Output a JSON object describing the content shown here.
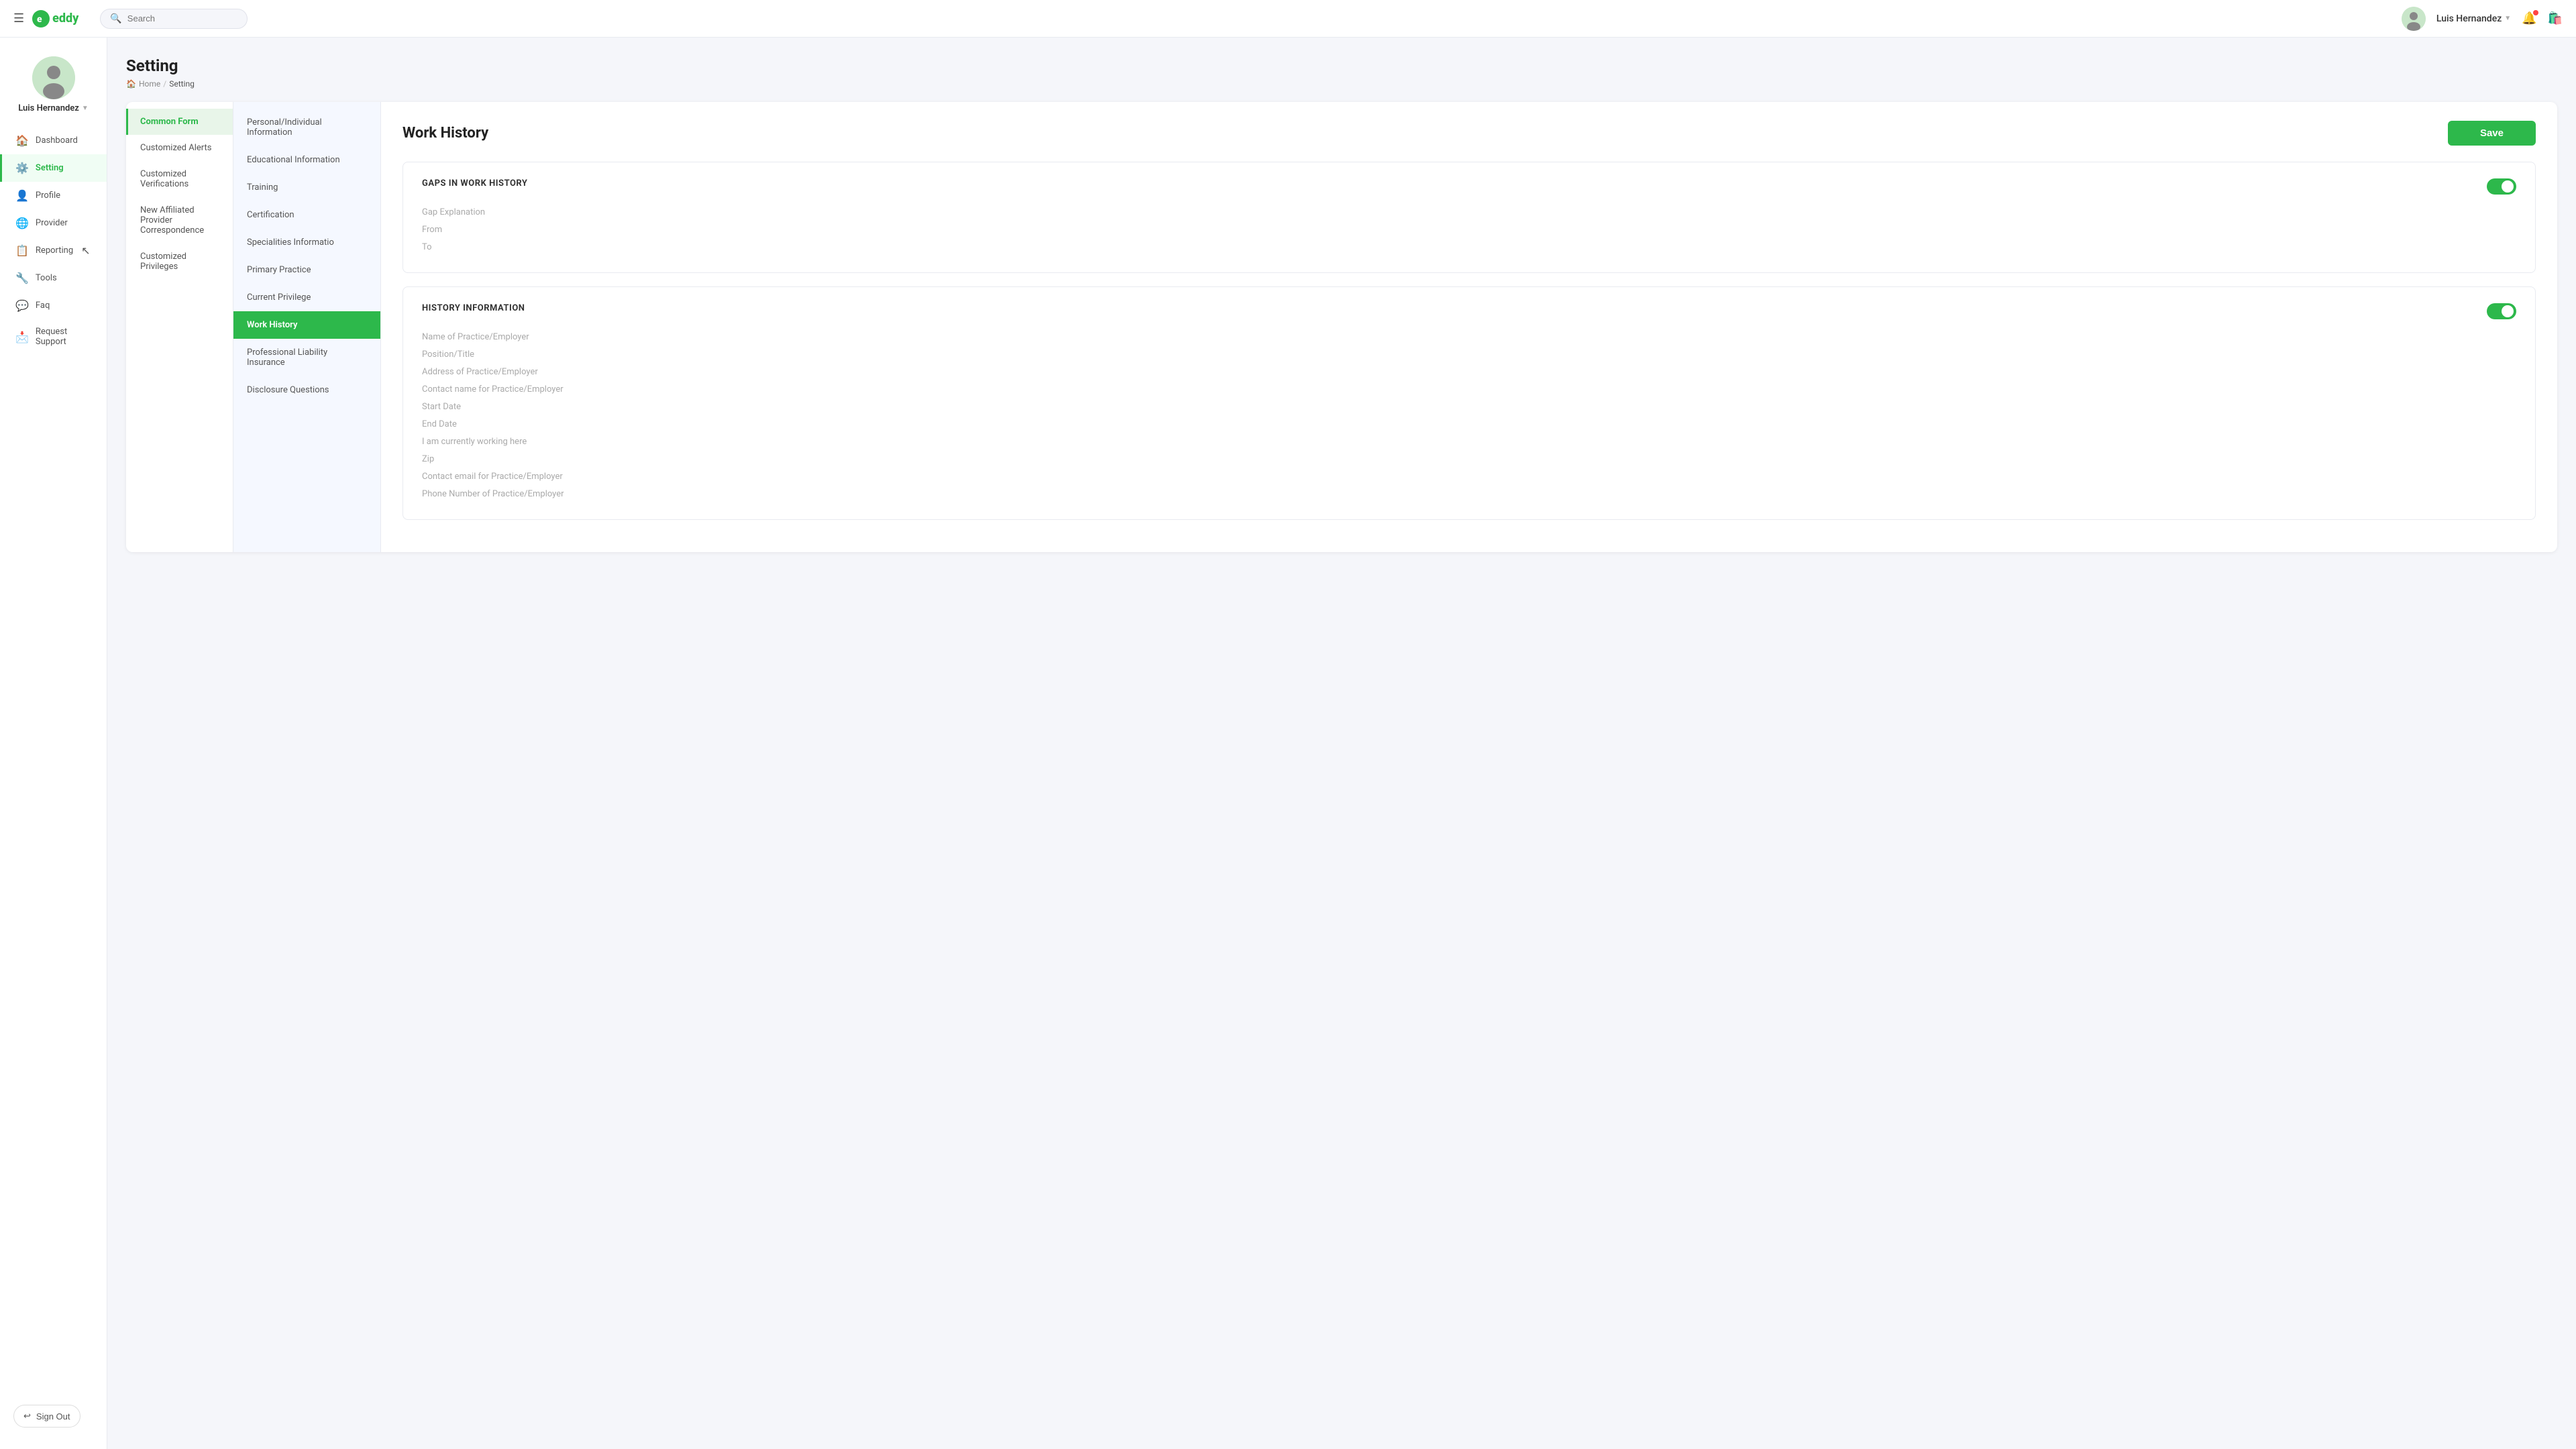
{
  "topnav": {
    "search_placeholder": "Search",
    "user_name": "Luis Hernandez",
    "bell_label": "Notifications",
    "bag_label": "Shopping bag"
  },
  "sidebar": {
    "user_name": "Luis Hernandez",
    "items": [
      {
        "label": "Dashboard",
        "icon": "🏠",
        "id": "dashboard",
        "active": false
      },
      {
        "label": "Setting",
        "icon": "⚙️",
        "id": "setting",
        "active": true
      },
      {
        "label": "Profile",
        "icon": "👤",
        "id": "profile",
        "active": false
      },
      {
        "label": "Provider",
        "icon": "🌐",
        "id": "provider",
        "active": false
      },
      {
        "label": "Reporting",
        "icon": "📋",
        "id": "reporting",
        "active": false
      },
      {
        "label": "Tools",
        "icon": "🔧",
        "id": "tools",
        "active": false
      },
      {
        "label": "Faq",
        "icon": "💬",
        "id": "faq",
        "active": false
      },
      {
        "label": "Request Support",
        "icon": "📩",
        "id": "request-support",
        "active": false
      }
    ],
    "sign_out": "Sign Out"
  },
  "page": {
    "title": "Setting",
    "breadcrumb_home": "Home",
    "breadcrumb_current": "Setting"
  },
  "subnav_col1": {
    "items": [
      {
        "label": "Common Form",
        "active": true
      }
    ]
  },
  "subnav_col2": {
    "items": [
      {
        "label": "Personal/Individual Information",
        "active": false
      },
      {
        "label": "Educational Information",
        "active": false
      },
      {
        "label": "Training",
        "active": false
      },
      {
        "label": "Certification",
        "active": false
      },
      {
        "label": "Specialities Informatio",
        "active": false
      },
      {
        "label": "Primary Practice",
        "active": false
      },
      {
        "label": "Current Privilege",
        "active": false
      },
      {
        "label": "Work History",
        "active": true
      },
      {
        "label": "Professional Liability Insurance",
        "active": false
      },
      {
        "label": "Disclosure Questions",
        "active": false
      }
    ]
  },
  "subnav_col1_extra": {
    "items": [
      {
        "label": "Customized Alerts",
        "active": false
      },
      {
        "label": "Customized Verifications",
        "active": false
      },
      {
        "label": "New Affiliated Provider Correspondence",
        "active": false
      },
      {
        "label": "Customized Privileges",
        "active": false
      }
    ]
  },
  "content": {
    "title": "Work History",
    "save_label": "Save",
    "sections": [
      {
        "id": "gaps-in-work-history",
        "title": "GAPS IN WORK HISTORY",
        "toggle_on": true,
        "fields": [
          "Gap Explanation",
          "From",
          "To"
        ]
      },
      {
        "id": "history-information",
        "title": "HISTORY INFORMATION",
        "toggle_on": true,
        "fields": [
          "Name of Practice/Employer",
          "Position/Title",
          "Address of Practice/Employer",
          "Contact name for Practice/Employer",
          "Start Date",
          "End Date",
          "I am currently working here",
          "Zip",
          "Contact email for Practice/Employer",
          "Phone Number of Practice/Employer"
        ]
      }
    ]
  }
}
